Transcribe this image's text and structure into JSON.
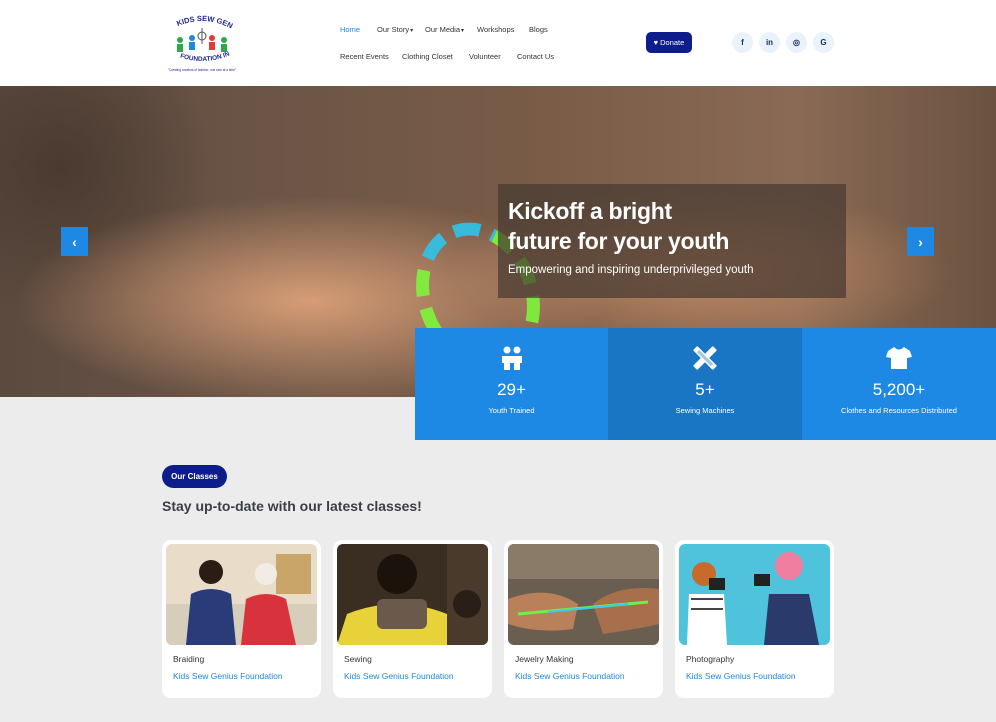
{
  "logo": {
    "text_top": "KIDS SEW GENIUS",
    "text_bottom": "FOUNDATION INC.",
    "tagline": "\"Creating creators of fashion, one sew at a time\""
  },
  "nav": {
    "row1": [
      {
        "label": "Home",
        "active": true
      },
      {
        "label": "Our Story",
        "caret": true
      },
      {
        "label": "Our Media",
        "caret": true
      },
      {
        "label": "Workshops"
      },
      {
        "label": "Blogs"
      }
    ],
    "row2": [
      {
        "label": "Recent Events"
      },
      {
        "label": "Clothing Closet"
      },
      {
        "label": "Volunteer"
      },
      {
        "label": "Contact Us"
      }
    ]
  },
  "donate": {
    "label": "Donate",
    "icon": "heart-icon"
  },
  "socials": [
    {
      "name": "facebook-icon",
      "glyph": "f"
    },
    {
      "name": "linkedin-icon",
      "glyph": "in"
    },
    {
      "name": "instagram-icon",
      "glyph": "◎"
    },
    {
      "name": "google-icon",
      "glyph": "G"
    }
  ],
  "hero": {
    "title_line1": "Kickoff a bright",
    "title_line2": "future for your youth",
    "subtitle": "Empowering and inspiring underprivileged youth",
    "prev": "‹",
    "next": "›"
  },
  "stats": [
    {
      "icon": "children-icon",
      "value": "29+",
      "label": "Youth Trained"
    },
    {
      "icon": "tools-icon",
      "value": "5+",
      "label": "Sewing Machines"
    },
    {
      "icon": "shirt-icon",
      "value": "5,200+",
      "label": "Clothes and Resources Distributed"
    }
  ],
  "classes": {
    "pill": "Our Classes",
    "title": "Stay up-to-date with our latest classes!",
    "cards": [
      {
        "title": "Braiding",
        "org": "Kids Sew Genius Foundation"
      },
      {
        "title": "Sewing",
        "org": "Kids Sew Genius Foundation"
      },
      {
        "title": "Jewelry Making",
        "org": "Kids Sew Genius Foundation"
      },
      {
        "title": "Photography",
        "org": "Kids Sew Genius Foundation"
      }
    ]
  },
  "colors": {
    "accent": "#1e88e5",
    "navy": "#0d1d8c",
    "stat_dark": "#1976c4"
  }
}
